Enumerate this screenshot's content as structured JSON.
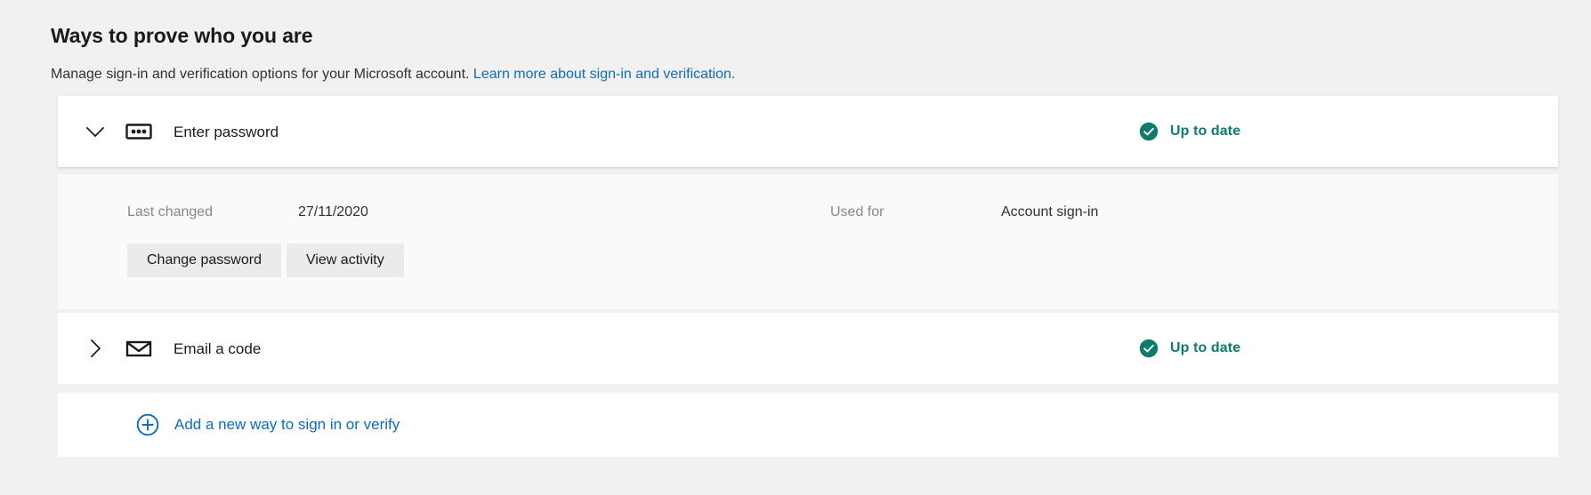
{
  "header": {
    "title": "Ways to prove who you are",
    "subtitle_text": "Manage sign-in and verification options for your Microsoft account.",
    "subtitle_link": "Learn more about sign-in and verification.",
    "link_color": "#0f6cbd"
  },
  "colors": {
    "page_background": "#f2f1f0",
    "card_background": "#ffffff",
    "detail_background": "#fafaf9",
    "status_teal": "#0f7b6c",
    "link_blue": "#0f6cbd",
    "button_grey": "#ebebeb",
    "muted_text": "#8a8886"
  },
  "methods": [
    {
      "id": "enter-password",
      "chevron_icon": "chevron-down-icon",
      "chevron_state": "expanded",
      "method_icon": "password-icon",
      "label": "Enter password",
      "status_icon": "check-circle-icon",
      "status_label": "Up to date",
      "expanded": true,
      "details": [
        {
          "key": "Last changed",
          "value": "27/11/2020"
        },
        {
          "key": "Used for",
          "value": "Account sign-in"
        }
      ],
      "buttons": [
        {
          "id": "change-password",
          "label": "Change password"
        },
        {
          "id": "view-activity",
          "label": "View activity"
        }
      ]
    },
    {
      "id": "email-a-code",
      "chevron_icon": "chevron-right-icon",
      "chevron_state": "collapsed",
      "method_icon": "envelope-icon",
      "label": "Email a code",
      "status_icon": "check-circle-icon",
      "status_label": "Up to date",
      "expanded": false
    }
  ],
  "add_new": {
    "icon": "plus-circle-icon",
    "label": "Add a new way to sign in or verify"
  }
}
